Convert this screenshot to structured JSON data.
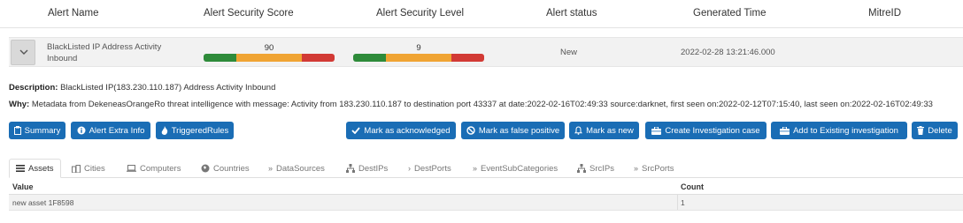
{
  "header": {
    "alert_name": "Alert Name",
    "security_score": "Alert Security Score",
    "security_level": "Alert Security Level",
    "status": "Alert status",
    "generated": "Generated Time",
    "mitre": "MitreID"
  },
  "alert": {
    "name_line1": "BlackListed IP Address Activity",
    "name_line2": "Inbound",
    "score": "90",
    "level": "9",
    "status": "New",
    "generated_time": "2022-02-28 13:21:46.000",
    "mitre_id": ""
  },
  "details": {
    "description_label": "Description:",
    "description": "BlackListed IP(183.230.110.187) Address Activity Inbound",
    "why_label": "Why:",
    "why": "Metadata from DekeneasOrangeRo threat intelligence with message: Activity from 183.230.110.187 to destination port 43337 at date:2022-02-16T02:49:33 source:darknet, first seen on:2022-02-12T07:15:40, last seen on:2022-02-16T02:49:33"
  },
  "buttons": {
    "summary": "Summary",
    "alert_extra_info": "Alert Extra Info",
    "triggered_rules": "TriggeredRules",
    "mark_acknowledged": "Mark as acknowledged",
    "mark_false_positive": "Mark as false positive",
    "mark_new": "Mark as new",
    "create_investigation": "Create Investigation case",
    "add_existing": "Add to Existing investigation",
    "delete": "Delete"
  },
  "tabs": [
    "Assets",
    "Cities",
    "Computers",
    "Countries",
    "DataSources",
    "DestIPs",
    "DestPorts",
    "EventSubCategories",
    "SrcIPs",
    "SrcPorts"
  ],
  "table": {
    "columns": [
      "Value",
      "Count"
    ],
    "rows": [
      {
        "value": "new asset 1F8598",
        "count": "1"
      }
    ]
  },
  "colors": {
    "primary": "#1a6db5",
    "gauge_green": "#2e8b3a",
    "gauge_orange": "#f0a433",
    "gauge_red": "#d23a35"
  }
}
